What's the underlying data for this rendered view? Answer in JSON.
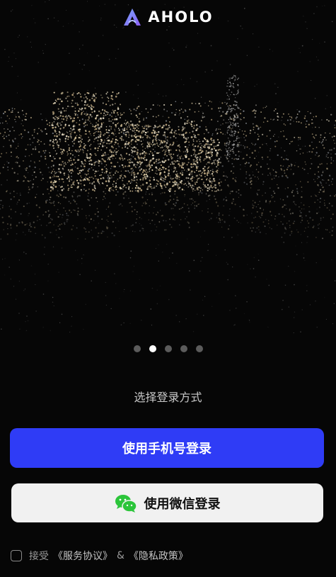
{
  "brand": {
    "name": "AHOLO"
  },
  "hero": {
    "slides_total": 5,
    "active_slide": 2
  },
  "login": {
    "subtitle": "选择登录方式",
    "phone_button": "使用手机号登录",
    "wechat_button": "使用微信登录"
  },
  "agreement": {
    "accept": "接受",
    "terms": "《服务协议》",
    "amp": "&",
    "privacy": "《隐私政策》"
  },
  "colors": {
    "primary": "#2f3cf6",
    "wechat_green": "#2bc53a",
    "background": "#060606"
  }
}
